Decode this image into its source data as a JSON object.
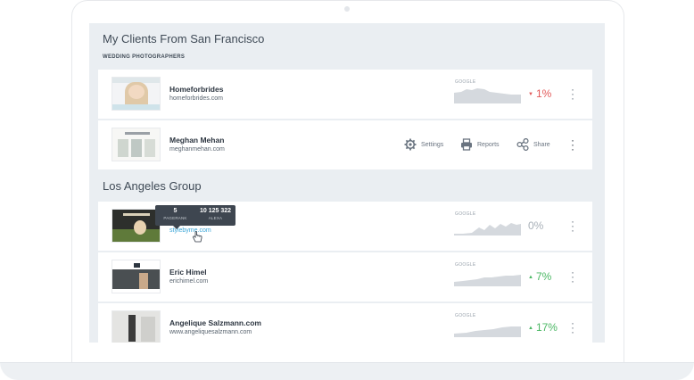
{
  "sections": [
    {
      "title": "My Clients From San Francisco",
      "subtitle": "WEDDING PHOTOGRAPHERS"
    },
    {
      "title": "Los Angeles Group"
    }
  ],
  "rows": [
    {
      "name": "Homeforbrides",
      "url": "homeforbrides.com",
      "metric_label": "GOOGLE",
      "change": "1%",
      "trend": "down"
    },
    {
      "name": "Meghan Mehan",
      "url": "meghanmehan.com",
      "actions": {
        "settings": "Settings",
        "reports": "Reports",
        "share": "Share"
      }
    },
    {
      "name": "",
      "url": "stylebyme.com",
      "metric_label": "GOOGLE",
      "change": "0%",
      "trend": "flat"
    },
    {
      "name": "Eric Himel",
      "url": "erichimel.com",
      "metric_label": "GOOGLE",
      "change": "7%",
      "trend": "up"
    },
    {
      "name": "Angelique Salzmann.com",
      "url": "www.angeliquesalzmann.com",
      "metric_label": "GOOGLE",
      "change": "17%",
      "trend": "up"
    }
  ],
  "tooltip": {
    "pagerank_value": "5",
    "pagerank_label": "PAGERANK",
    "alexa_value": "10 125 322",
    "alexa_label": "ALEXA"
  },
  "colors": {
    "negative": "#e25a5a",
    "positive": "#4cb865",
    "neutral": "#a8b0b8",
    "link": "#3ba6d8"
  }
}
